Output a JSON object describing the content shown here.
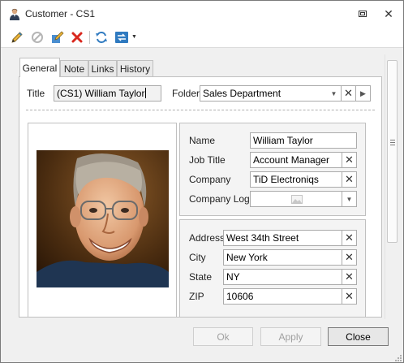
{
  "window": {
    "title": "Customer - CS1",
    "colors": {
      "accent": "#3c7fb1",
      "delete_red": "#d9281e"
    }
  },
  "toolbar": {
    "items": [
      "edit-pencil-icon",
      "cancel-icon",
      "edit-form-icon",
      "delete-icon",
      "refresh-icon",
      "navigation-icon"
    ]
  },
  "tabs": [
    "General",
    "Note",
    "Links",
    "History"
  ],
  "header": {
    "title_label": "Title",
    "title_value": "(CS1) William Taylor",
    "folder_label": "Folder",
    "folder_value": "Sales Department"
  },
  "details": {
    "name_label": "Name",
    "name_value": "William Taylor",
    "job_title_label": "Job Title",
    "job_title_value": "Account Manager",
    "company_label": "Company",
    "company_value": "TiD Electroniqs",
    "company_logo_label": "Company Logo"
  },
  "address": {
    "address_label": "Address",
    "address_value": "West 34th Street",
    "city_label": "City",
    "city_value": "New York",
    "state_label": "State",
    "state_value": "NY",
    "zip_label": "ZIP",
    "zip_value": "10606"
  },
  "buttons": {
    "ok": "Ok",
    "apply": "Apply",
    "close": "Close"
  }
}
